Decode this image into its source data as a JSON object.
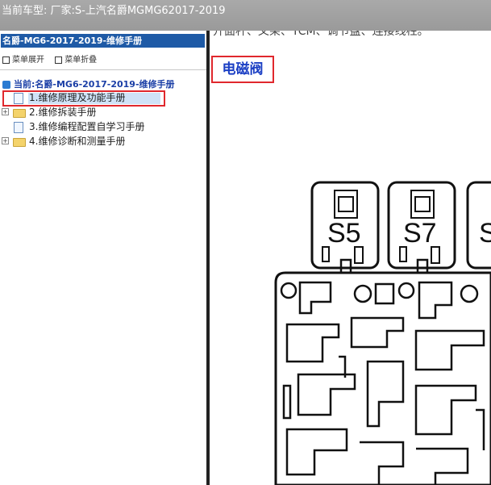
{
  "header": {
    "vehicle_text": "当前车型:  厂家:S-上汽名爵MGMG62017-2019"
  },
  "sidebar": {
    "title": "名爵-MG6-2017-2019-维修手册",
    "expand_label": "菜单展开",
    "collapse_label": "菜单折叠",
    "current_label": "当前:名爵-MG6-2017-2019-维修手册",
    "items": [
      {
        "label": "1.维修原理及功能手册",
        "type": "doc",
        "selected": true
      },
      {
        "label": "2.维修拆装手册",
        "type": "folder"
      },
      {
        "label": "3.维修编程配置自学习手册",
        "type": "doc"
      },
      {
        "label": "4.维修诊断和测量手册",
        "type": "folder"
      }
    ]
  },
  "content": {
    "cut_text": "开面杆、叉架、TCM、调节盘、连接线柱。",
    "heading": "电磁阀",
    "diagram_labels": [
      "S5",
      "S7",
      "S"
    ]
  }
}
